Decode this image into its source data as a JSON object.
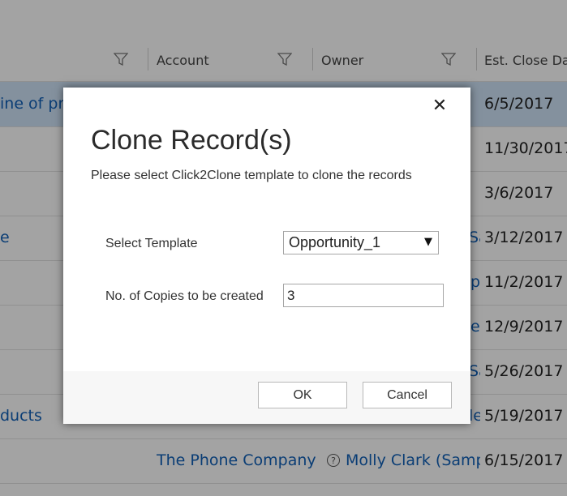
{
  "grid": {
    "columns": [
      {
        "label": ""
      },
      {
        "label": "Account"
      },
      {
        "label": "Owner"
      },
      {
        "label": "Est. Close Date"
      }
    ],
    "rows": [
      {
        "topic": "ine of pri",
        "account": "",
        "owner": "",
        "date": "6/5/2017",
        "selected": true
      },
      {
        "topic": "",
        "account": "",
        "owner": "",
        "date": "11/30/2017"
      },
      {
        "topic": "",
        "account": "",
        "owner": "",
        "date": "3/6/2017"
      },
      {
        "topic": "e",
        "account": "",
        "owner": "Sa",
        "date": "3/12/2017"
      },
      {
        "topic": "",
        "account": "",
        "owner": "p",
        "date": "11/2/2017"
      },
      {
        "topic": "",
        "account": "",
        "owner": "e",
        "date": "12/9/2017"
      },
      {
        "topic": "",
        "account": "",
        "owner": "Sa",
        "date": "5/26/2017"
      },
      {
        "topic": "ducts",
        "account": "",
        "owner": "le",
        "date": "5/19/2017"
      },
      {
        "topic": "",
        "account": "The Phone Company",
        "owner": "Molly Clark (Sample",
        "date": "6/15/2017"
      }
    ]
  },
  "dialog": {
    "close_glyph": "✕",
    "title": "Clone Record(s)",
    "subtitle": "Please select Click2Clone template to clone the records",
    "template_label": "Select Template",
    "template_value": "Opportunity_1",
    "template_arrow": "▼",
    "copies_label": "No. of Copies to be created",
    "copies_value": "3",
    "ok_label": "OK",
    "cancel_label": "Cancel"
  }
}
